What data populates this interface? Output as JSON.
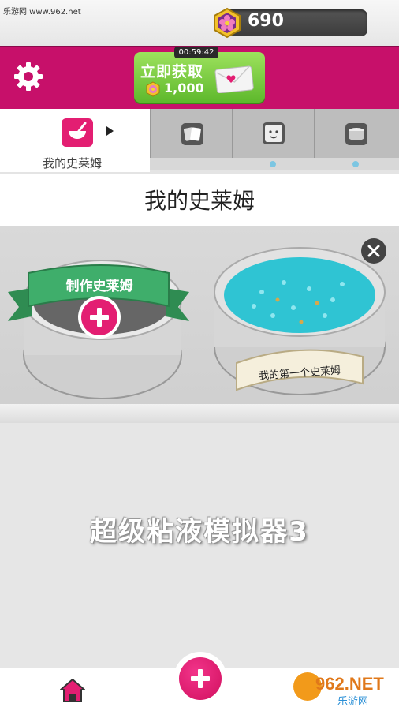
{
  "watermark_top": "乐游网 www.962.net",
  "currency": {
    "amount": "690"
  },
  "offer": {
    "timer": "00:59:42",
    "title": "立即获取",
    "amount": "1,000"
  },
  "tabs": [
    {
      "label": "我的史莱姆",
      "active": true,
      "icon": "slime-bowl-icon"
    },
    {
      "label": "",
      "icon": "cards-icon",
      "has_dot": false
    },
    {
      "label": "",
      "icon": "face-icon",
      "has_dot": true
    },
    {
      "label": "",
      "icon": "container-icon",
      "has_dot": true
    }
  ],
  "section_title": "我的史莱姆",
  "slimes": {
    "create_label": "制作史莱姆",
    "first_slime_label": "我的第一个史莱姆"
  },
  "game_title": "超级粘液模拟器3",
  "watermark_br": {
    "brand": "962.NET",
    "site": "乐游网"
  },
  "colors": {
    "accent": "#e31e72",
    "banner": "#c7106a",
    "slime": "#2fc4d3",
    "ribbon": "#3fae6b"
  }
}
